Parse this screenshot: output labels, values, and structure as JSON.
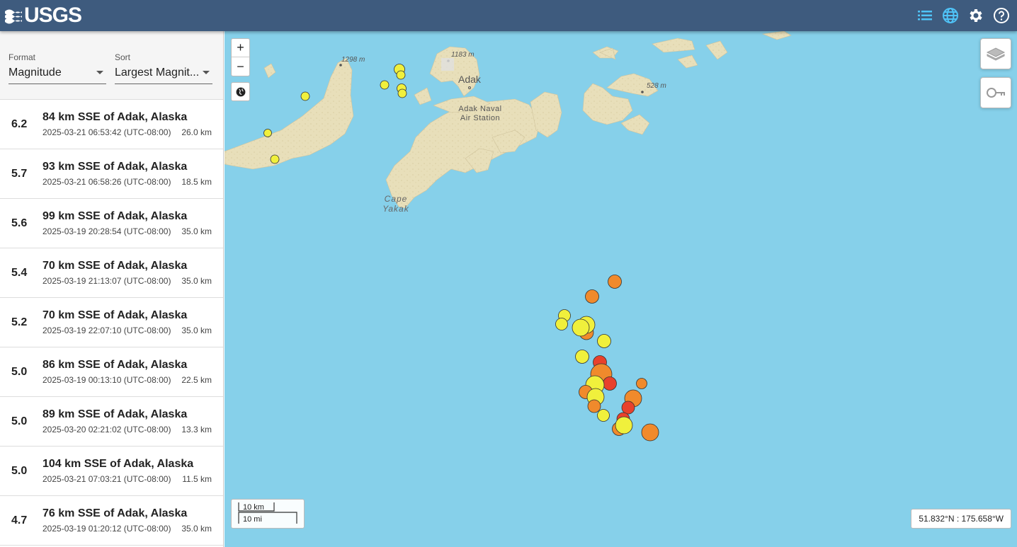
{
  "header": {
    "logo_text": "USGS",
    "icons": [
      "list-icon",
      "globe-icon",
      "settings-icon",
      "help-icon"
    ],
    "background_color": "#3e5b7e",
    "accent_color": "#4fc3f7"
  },
  "controls": {
    "format_label": "Format",
    "format_value": "Magnitude",
    "sort_label": "Sort",
    "sort_value": "Largest Magnit..."
  },
  "earthquakes": [
    {
      "mag": "6.2",
      "place": "84 km SSE of Adak, Alaska",
      "time": "2025-03-21 06:53:42 (UTC-08:00)",
      "depth": "26.0 km"
    },
    {
      "mag": "5.7",
      "place": "93 km SSE of Adak, Alaska",
      "time": "2025-03-21 06:58:26 (UTC-08:00)",
      "depth": "18.5 km"
    },
    {
      "mag": "5.6",
      "place": "99 km SSE of Adak, Alaska",
      "time": "2025-03-19 20:28:54 (UTC-08:00)",
      "depth": "35.0 km"
    },
    {
      "mag": "5.4",
      "place": "70 km SSE of Adak, Alaska",
      "time": "2025-03-19 21:13:07 (UTC-08:00)",
      "depth": "35.0 km"
    },
    {
      "mag": "5.2",
      "place": "70 km SSE of Adak, Alaska",
      "time": "2025-03-19 22:07:10 (UTC-08:00)",
      "depth": "35.0 km"
    },
    {
      "mag": "5.0",
      "place": "86 km SSE of Adak, Alaska",
      "time": "2025-03-19 00:13:10 (UTC-08:00)",
      "depth": "22.5 km"
    },
    {
      "mag": "5.0",
      "place": "89 km SSE of Adak, Alaska",
      "time": "2025-03-20 02:21:02 (UTC-08:00)",
      "depth": "13.3 km"
    },
    {
      "mag": "5.0",
      "place": "104 km SSE of Adak, Alaska",
      "time": "2025-03-21 07:03:21 (UTC-08:00)",
      "depth": "11.5 km"
    },
    {
      "mag": "4.7",
      "place": "76 km SSE of Adak, Alaska",
      "time": "2025-03-19 01:20:12 (UTC-08:00)",
      "depth": "35.0 km"
    }
  ],
  "map": {
    "zoom_in": "+",
    "zoom_out": "−",
    "labels": {
      "adak": "Adak",
      "naval_station": "Adak Naval Air Station",
      "cape": "Cape Yakak",
      "elev1": "1298 m",
      "elev2": "1183 m",
      "elev3": "528 m"
    },
    "scale_km": "10 km",
    "scale_mi": "10 mi",
    "coordinates": "51.832°N : 175.658°W",
    "colors": {
      "water": "#86d0ea",
      "land": "#e8dfba",
      "recent": "#f0f03c",
      "day": "#f08a2c",
      "hour": "#e8412c"
    }
  }
}
